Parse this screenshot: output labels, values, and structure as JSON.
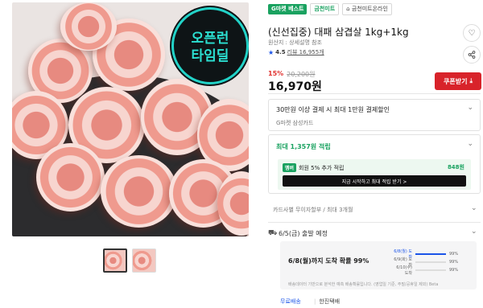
{
  "product": {
    "badge_lines": [
      "오픈런",
      "타임딜"
    ],
    "tags": {
      "best": "G마켓 베스트",
      "seller": "금천미트",
      "store": "금천미트온라인"
    },
    "title": "(신선집중) 대패 삼겹살 1kg+1kg",
    "origin": "원산지 : 상세설명 참조",
    "rating": "4.5",
    "review_text": "리뷰 16,955개",
    "discount_pct": "15%",
    "original_price": "20,200원",
    "price": "16,970원",
    "coupon_label": "쿠폰받기"
  },
  "card_benefit": {
    "line1": "30만원 이상 결제 시 최대 1만원 결제할인",
    "line2": "G마켓 삼성카드"
  },
  "reward": {
    "head": "최대 1,357원 적립",
    "member_badge": "멤버",
    "member_text": "회원 5% 추가 적립",
    "member_points": "848원",
    "member_button": "지금 시작하고 최대 적립 받기 >"
  },
  "installment": "카드사별 무이자할부 / 최대 3개월",
  "shipping": {
    "date": "6/5(금) 출발 예정",
    "eta_main": "6/8(월)까지 도착 확률 99%",
    "eta_rows": [
      {
        "label": "6/8(월) 도착",
        "pct": "99%",
        "fill": 0.99
      },
      {
        "label": "6/9(화) 도착",
        "pct": "99%",
        "fill": 0.0
      },
      {
        "label": "6/10(수) 도착",
        "pct": "99%",
        "fill": 0.0
      }
    ],
    "eta_note": "배송데이터 기반으로 분석한 예측 배송확률입니다. (영업일 기준, 주말/공휴일 제외) Beta",
    "free_shipping": "무료배송",
    "courier": "한진택배"
  },
  "colors": {
    "accent_red": "#d8232a",
    "brand_green": "#1aa260",
    "link_blue": "#1b54e8"
  },
  "icons": {
    "wishlist": "heart-icon",
    "share": "share-icon",
    "coupon": "download-icon",
    "shipping": "truck-icon"
  }
}
